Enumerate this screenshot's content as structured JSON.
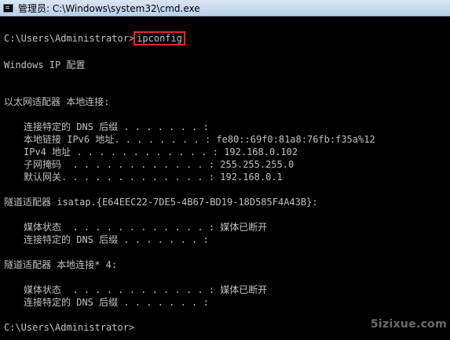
{
  "window": {
    "title": "管理员: C:\\Windows\\system32\\cmd.exe",
    "icon": "cmd-console-icon"
  },
  "console": {
    "prompt1": "C:\\Users\\Administrator>",
    "command": "ipconfig",
    "header": "Windows IP 配置",
    "eth_section": "以太网适配器 本地连接:",
    "eth_lines": [
      "连接特定的 DNS 后缀 . . . . . . . :",
      "本地链接 IPv6 地址. . . . . . . . : fe80::69f0:81a8:76fb:f35a%12",
      "IPv4 地址 . . . . . . . . . . . . : 192.168.0.102",
      "子网掩码  . . . . . . . . . . . . : 255.255.255.0",
      "默认网关. . . . . . . . . . . . . : 192.168.0.1"
    ],
    "tunnel1_section": "隧道适配器 isatap.{E64EEC22-7DE5-4B67-BD19-18D585F4A43B}:",
    "tunnel1_lines": [
      "媒体状态  . . . . . . . . . . . . : 媒体已断开",
      "连接特定的 DNS 后缀 . . . . . . . :"
    ],
    "tunnel2_section": "隧道适配器 本地连接* 4:",
    "tunnel2_lines": [
      "媒体状态  . . . . . . . . . . . . : 媒体已断开",
      "连接特定的 DNS 后缀 . . . . . . . :"
    ],
    "prompt2": "C:\\Users\\Administrator>"
  },
  "watermark": "5izixue.com",
  "colors": {
    "background": "#000000",
    "text": "#c0c0c0",
    "highlight_border": "#e02b2b"
  }
}
